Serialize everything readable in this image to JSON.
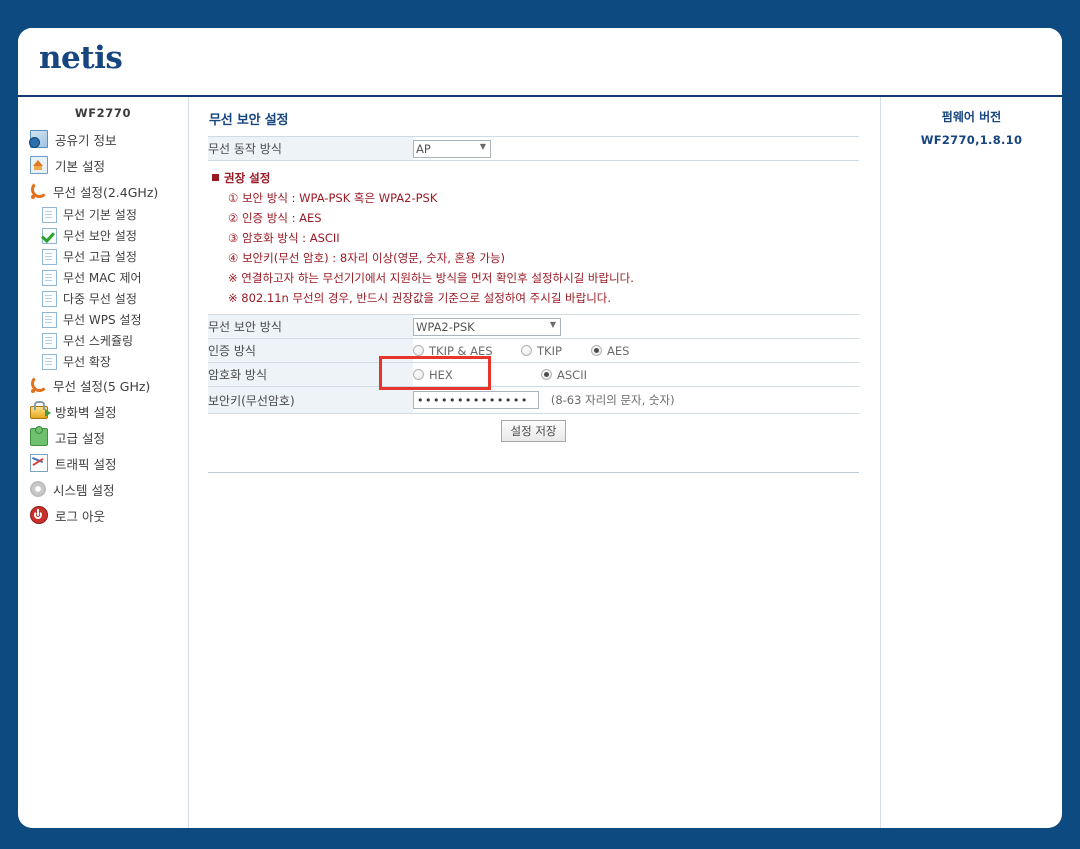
{
  "brand": {
    "logo_text": "netis"
  },
  "sidebar": {
    "model": "WF2770",
    "items": [
      {
        "label": "공유기 정보",
        "icon": "router-info-icon",
        "level": 0,
        "icon_class": "ic-info"
      },
      {
        "label": "기본 설정",
        "icon": "home-icon",
        "level": 0,
        "icon_class": "ic-home"
      },
      {
        "label": "무선 설정(2.4GHz)",
        "icon": "wifi-icon",
        "level": 0,
        "icon_class": "ic-wifi"
      },
      {
        "label": "무선 기본 설정",
        "icon": "page-icon",
        "level": 1,
        "icon_class": "ic-page"
      },
      {
        "label": "무선 보안 설정",
        "icon": "check-icon",
        "level": 1,
        "icon_class": "ic-check"
      },
      {
        "label": "무선 고급 설정",
        "icon": "page-icon",
        "level": 1,
        "icon_class": "ic-page"
      },
      {
        "label": "무선 MAC 제어",
        "icon": "page-icon",
        "level": 1,
        "icon_class": "ic-page"
      },
      {
        "label": "다중 무선 설정",
        "icon": "page-icon",
        "level": 1,
        "icon_class": "ic-page"
      },
      {
        "label": "무선 WPS 설정",
        "icon": "page-icon",
        "level": 1,
        "icon_class": "ic-page"
      },
      {
        "label": "무선 스케쥴링",
        "icon": "page-icon",
        "level": 1,
        "icon_class": "ic-page"
      },
      {
        "label": "무선 확장",
        "icon": "page-icon",
        "level": 1,
        "icon_class": "ic-page"
      },
      {
        "label": "무선 설정(5 GHz)",
        "icon": "wifi-icon",
        "level": 0,
        "icon_class": "ic-wifi"
      },
      {
        "label": "방화벽 설정",
        "icon": "lock-icon",
        "level": 0,
        "icon_class": "ic-lock"
      },
      {
        "label": "고급 설정",
        "icon": "puzzle-icon",
        "level": 0,
        "icon_class": "ic-puzzle"
      },
      {
        "label": "트래픽 설정",
        "icon": "chart-icon",
        "level": 0,
        "icon_class": "ic-chart"
      },
      {
        "label": "시스템 설정",
        "icon": "gear-icon",
        "level": 0,
        "icon_class": "ic-gear"
      },
      {
        "label": "로그 아웃",
        "icon": "power-icon",
        "level": 0,
        "icon_class": "ic-power"
      }
    ]
  },
  "main": {
    "page_title": "무선 보안 설정",
    "mode_row": {
      "label": "무선 동작 방식",
      "value": "AP",
      "options": [
        "AP"
      ]
    },
    "recommend": {
      "heading": "권장 설정",
      "lines": [
        "① 보안 방식 : WPA-PSK 혹은 WPA2-PSK",
        "② 인증 방식 : AES",
        "③ 암호화 방식 : ASCII",
        "④ 보안키(무선 암호) : 8자리 이상(영문, 숫자, 혼용 가능)",
        "※ 연결하고자 하는 무선기기에서 지원하는 방식을 먼저 확인후 설정하시길 바랍니다.",
        "※ 802.11n 무선의 경우, 반드시 권장값을 기준으로 설정하여 주시길 바랍니다."
      ]
    },
    "security_mode_row": {
      "label": "무선 보안 방식",
      "value": "WPA2-PSK",
      "options": [
        "WPA2-PSK"
      ]
    },
    "auth_row": {
      "label": "인증 방식",
      "options": [
        {
          "label": "TKIP & AES",
          "selected": false
        },
        {
          "label": "TKIP",
          "selected": false
        },
        {
          "label": "AES",
          "selected": true
        }
      ]
    },
    "encrypt_row": {
      "label": "암호화 방식",
      "options": [
        {
          "label": "HEX",
          "selected": false
        },
        {
          "label": "ASCII",
          "selected": true
        }
      ]
    },
    "key_row": {
      "label": "보안키(무선암호)",
      "value": "••••••••••••••",
      "placeholder": "",
      "hint": "(8-63 자리의 문자, 숫자)"
    },
    "save_button": "설정 저장"
  },
  "rightbar": {
    "firmware_label": "펌웨어 버전",
    "firmware_value": "WF2770,1.8.10"
  },
  "colors": {
    "page_background": "#0c4a80",
    "brand": "#17457f",
    "recommend_text": "#9a1a24",
    "highlight_border": "#e8352b",
    "row_label_bg": "#eef3f8"
  }
}
